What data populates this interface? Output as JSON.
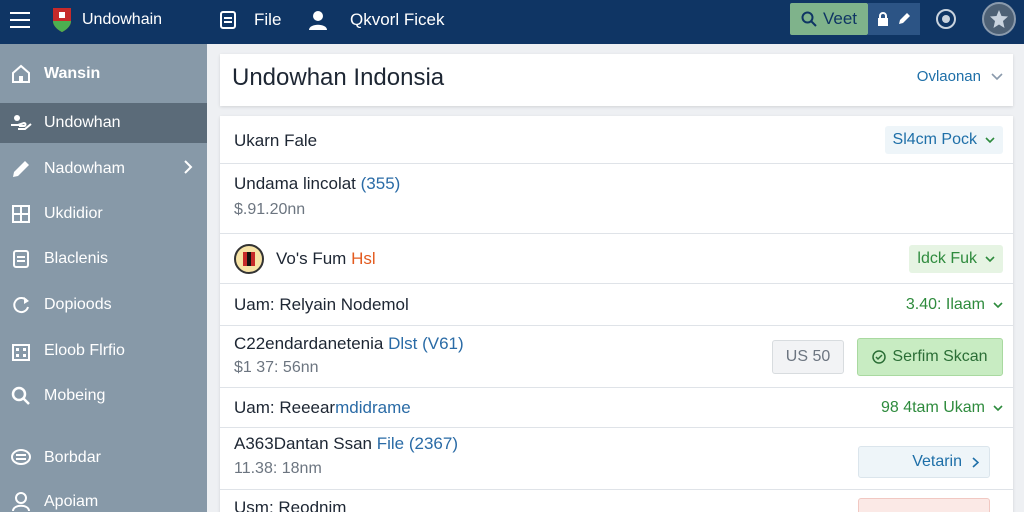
{
  "topbar": {
    "brand": "Undowhain",
    "file_label": "File",
    "search_text": "Qkvorl Ficek",
    "search_button": "Veet"
  },
  "sidebar": {
    "items": [
      {
        "label": "Wansin",
        "icon": "home-icon"
      },
      {
        "label": "Undowhan",
        "icon": "hand-icon"
      },
      {
        "label": "Nadowham",
        "icon": "pencil-icon"
      },
      {
        "label": "Ukdidior",
        "icon": "grid-icon"
      },
      {
        "label": "Blaclenis",
        "icon": "document-icon"
      },
      {
        "label": "Dopioods",
        "icon": "refresh-icon"
      },
      {
        "label": "Eloob Flrfio",
        "icon": "building-icon"
      },
      {
        "label": "Mobeing",
        "icon": "search-icon"
      },
      {
        "label": "Borbdar",
        "icon": "chat-icon"
      },
      {
        "label": "Apoiam",
        "icon": "user-icon"
      }
    ]
  },
  "header": {
    "title": "Undowhan Indonsia",
    "dropdown": "Ovlaonan"
  },
  "rows": {
    "r1": {
      "title": "Ukarn Fale",
      "right": "Sl4cm Pock"
    },
    "r2": {
      "title": "Undama lincolat",
      "title_count": "(355)",
      "sub": "$.91.20nn"
    },
    "r3": {
      "title": "Vo's Fum",
      "title_tag": "Hsl",
      "right": "ldck Fuk"
    },
    "r4": {
      "title": "Uam: Relyain Nodemol",
      "right": "3.40: Ilaam"
    },
    "r5": {
      "title": "C22endardanetenia",
      "title_blue": "Dlst (V61)",
      "sub": "$1 37: 56nn",
      "btn_secondary": "US 50",
      "btn_primary": "Serfim Skcan"
    },
    "r6": {
      "title": "Uam: Reeear",
      "title_blue": "mdidrame",
      "right": "98 4tam Ukam"
    },
    "r7": {
      "title": "A363Dantan Ssan",
      "title_blue": "File (2367)",
      "sub": "11.38: 18nm",
      "btn": "Vetarin"
    },
    "r8": {
      "title": "Usm: Reodnim"
    }
  },
  "colors": {
    "topbar": "#0f3564",
    "sidebar": "#8799a8",
    "sidebar_active": "#5b6b79",
    "accent_green": "#2e8b3d",
    "accent_blue": "#1e6fa8"
  }
}
